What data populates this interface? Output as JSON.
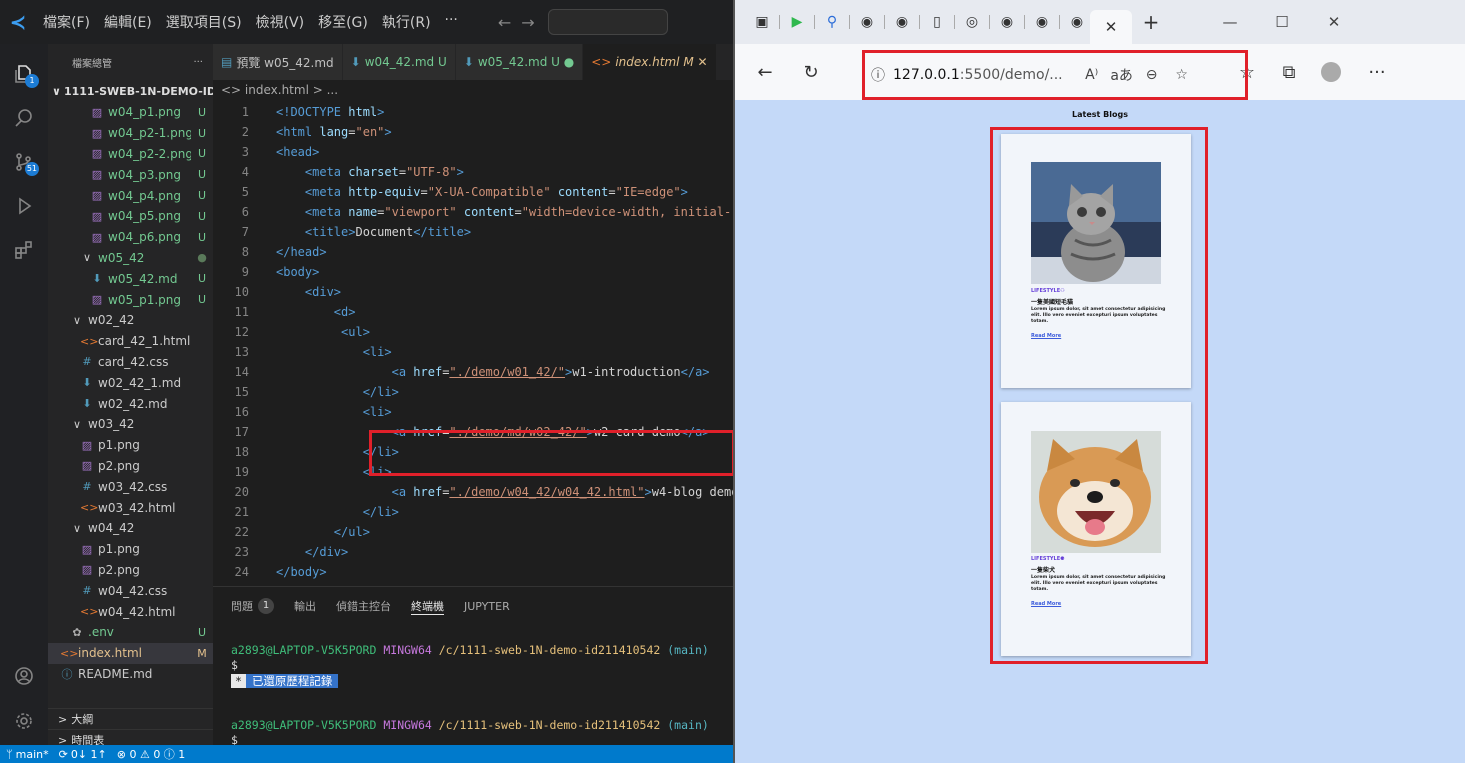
{
  "titlebar": {
    "menus": [
      "檔案(F)",
      "編輯(E)",
      "選取項目(S)",
      "檢視(V)",
      "移至(G)",
      "執行(R)",
      "···"
    ]
  },
  "activity": {
    "explorer_badge": "1",
    "scm_badge": "51"
  },
  "sidebar": {
    "header": "檔案總管",
    "more": "···",
    "root": "1111-SWEB-1N-DEMO-ID2...",
    "rows": [
      {
        "icon": "image",
        "name": "w04_p1.png",
        "status": "U",
        "depth": 3
      },
      {
        "icon": "image",
        "name": "w04_p2-1.png",
        "status": "U",
        "depth": 3
      },
      {
        "icon": "image",
        "name": "w04_p2-2.png",
        "status": "U",
        "depth": 3
      },
      {
        "icon": "image",
        "name": "w04_p3.png",
        "status": "U",
        "depth": 3
      },
      {
        "icon": "image",
        "name": "w04_p4.png",
        "status": "U",
        "depth": 3
      },
      {
        "icon": "image",
        "name": "w04_p5.png",
        "status": "U",
        "depth": 3
      },
      {
        "icon": "image",
        "name": "w04_p6.png",
        "status": "U",
        "depth": 3
      },
      {
        "icon": "folder",
        "name": "w05_42",
        "status": "●",
        "depth": 2
      },
      {
        "icon": "md",
        "name": "w05_42.md",
        "status": "U",
        "depth": 3
      },
      {
        "icon": "image",
        "name": "w05_p1.png",
        "status": "U",
        "depth": 3
      },
      {
        "icon": "folder",
        "name": "w02_42",
        "status": "",
        "depth": 1
      },
      {
        "icon": "html",
        "name": "card_42_1.html",
        "status": "",
        "depth": 2
      },
      {
        "icon": "css",
        "name": "card_42.css",
        "status": "",
        "depth": 2
      },
      {
        "icon": "md",
        "name": "w02_42_1.md",
        "status": "",
        "depth": 2
      },
      {
        "icon": "md",
        "name": "w02_42.md",
        "status": "",
        "depth": 2
      },
      {
        "icon": "folder",
        "name": "w03_42",
        "status": "",
        "depth": 1
      },
      {
        "icon": "image",
        "name": "p1.png",
        "status": "",
        "depth": 2
      },
      {
        "icon": "image",
        "name": "p2.png",
        "status": "",
        "depth": 2
      },
      {
        "icon": "css",
        "name": "w03_42.css",
        "status": "",
        "depth": 2
      },
      {
        "icon": "html",
        "name": "w03_42.html",
        "status": "",
        "depth": 2
      },
      {
        "icon": "folder",
        "name": "w04_42",
        "status": "",
        "depth": 1
      },
      {
        "icon": "image",
        "name": "p1.png",
        "status": "",
        "depth": 2
      },
      {
        "icon": "image",
        "name": "p2.png",
        "status": "",
        "depth": 2
      },
      {
        "icon": "css",
        "name": "w04_42.css",
        "status": "",
        "depth": 2
      },
      {
        "icon": "html",
        "name": "w04_42.html",
        "status": "",
        "depth": 2
      },
      {
        "icon": "gear",
        "name": ".env",
        "status": "U",
        "depth": 1
      },
      {
        "icon": "html",
        "name": "index.html",
        "status": "M",
        "depth": 0,
        "selected": true
      },
      {
        "icon": "info",
        "name": "README.md",
        "status": "",
        "depth": 0
      }
    ],
    "outline": "大綱",
    "timeline": "時間表"
  },
  "tabs": [
    {
      "label": "預覽 w05_42.md",
      "color": "#c0c0c0"
    },
    {
      "label": "w04_42.md U",
      "color": "#73c991"
    },
    {
      "label": "w05_42.md U ●",
      "color": "#73c991"
    },
    {
      "label": "index.html M ✕",
      "color": "#e2c08d",
      "active": true
    }
  ],
  "breadcrumb": "<> index.html > ...",
  "code": [
    [
      [
        "tg",
        "<!DOCTYPE "
      ],
      [
        "at",
        "html"
      ],
      [
        "tg",
        ">"
      ]
    ],
    [
      [
        "tg",
        "<html "
      ],
      [
        "at",
        "lang"
      ],
      [
        "tx",
        "="
      ],
      [
        "sv",
        "\"en\""
      ],
      [
        "tg",
        ">"
      ]
    ],
    [
      [
        "tg",
        "<head>"
      ]
    ],
    [
      [
        "tx",
        "    "
      ],
      [
        "tg",
        "<meta "
      ],
      [
        "at",
        "charset"
      ],
      [
        "tx",
        "="
      ],
      [
        "sv",
        "\"UTF-8\""
      ],
      [
        "tg",
        ">"
      ]
    ],
    [
      [
        "tx",
        "    "
      ],
      [
        "tg",
        "<meta "
      ],
      [
        "at",
        "http-equiv"
      ],
      [
        "tx",
        "="
      ],
      [
        "sv",
        "\"X-UA-Compatible\""
      ],
      [
        "tx",
        " "
      ],
      [
        "at",
        "content"
      ],
      [
        "tx",
        "="
      ],
      [
        "sv",
        "\"IE=edge\""
      ],
      [
        "tg",
        ">"
      ]
    ],
    [
      [
        "tx",
        "    "
      ],
      [
        "tg",
        "<meta "
      ],
      [
        "at",
        "name"
      ],
      [
        "tx",
        "="
      ],
      [
        "sv",
        "\"viewport\""
      ],
      [
        "tx",
        " "
      ],
      [
        "at",
        "content"
      ],
      [
        "tx",
        "="
      ],
      [
        "sv",
        "\"width=device-width, initial-"
      ]
    ],
    [
      [
        "tx",
        "    "
      ],
      [
        "tg",
        "<title>"
      ],
      [
        "tx",
        "Document"
      ],
      [
        "tg",
        "</title>"
      ]
    ],
    [
      [
        "tg",
        "</head>"
      ]
    ],
    [
      [
        "tg",
        "<body>"
      ]
    ],
    [
      [
        "tx",
        "    "
      ],
      [
        "tg",
        "<div>"
      ]
    ],
    [
      [
        "tx",
        "        "
      ],
      [
        "tg",
        "<d>"
      ]
    ],
    [
      [
        "tx",
        "         "
      ],
      [
        "tg",
        "<ul>"
      ]
    ],
    [
      [
        "tx",
        "            "
      ],
      [
        "tg",
        "<li>"
      ]
    ],
    [
      [
        "tx",
        "                "
      ],
      [
        "tg",
        "<a "
      ],
      [
        "at",
        "href"
      ],
      [
        "tx",
        "="
      ],
      [
        "lk",
        "\"./demo/w01_42/\""
      ],
      [
        "tg",
        ">"
      ],
      [
        "tx",
        "w1-introduction"
      ],
      [
        "tg",
        "</a>"
      ]
    ],
    [
      [
        "tx",
        "            "
      ],
      [
        "tg",
        "</li>"
      ]
    ],
    [
      [
        "tx",
        "            "
      ],
      [
        "tg",
        "<li>"
      ]
    ],
    [
      [
        "tx",
        "                "
      ],
      [
        "tg",
        "<a "
      ],
      [
        "at",
        "href"
      ],
      [
        "tx",
        "="
      ],
      [
        "lk",
        "\"./demo/md/w02_42/\""
      ],
      [
        "tg",
        ">"
      ],
      [
        "tx",
        "w2-card demo"
      ],
      [
        "tg",
        "</a>"
      ]
    ],
    [
      [
        "tx",
        "            "
      ],
      [
        "tg",
        "</li>"
      ]
    ],
    [
      [
        "tx",
        "            "
      ],
      [
        "tg",
        "<li>"
      ]
    ],
    [
      [
        "tx",
        "                "
      ],
      [
        "tg",
        "<a "
      ],
      [
        "at",
        "href"
      ],
      [
        "tx",
        "="
      ],
      [
        "lk",
        "\"./demo/w04_42/w04_42.html\""
      ],
      [
        "tg",
        ">"
      ],
      [
        "tx",
        "w4-blog demo"
      ]
    ],
    [
      [
        "tx",
        "            "
      ],
      [
        "tg",
        "</li>"
      ]
    ],
    [
      [
        "tx",
        "        "
      ],
      [
        "tg",
        "</ul>"
      ]
    ],
    [
      [
        "tx",
        "    "
      ],
      [
        "tg",
        "</div>"
      ]
    ],
    [
      [
        "tg",
        "</body>"
      ]
    ],
    [
      [
        "tg",
        "</html>"
      ]
    ]
  ],
  "panel": {
    "problems": "問題",
    "problems_count": "1",
    "output": "輸出",
    "debug": "偵錯主控台",
    "terminal": "終端機",
    "jupyter": "JUPYTER"
  },
  "terminal": {
    "user": "a2893@LAPTOP-V5K5PORD",
    "shell": "MINGW64",
    "path1": "/c/1111-sweb-1N-demo-id211410542",
    "path2": "/c/1111-sweb-1N-demo-id211410542",
    "branch": "(main)",
    "prompt": "$",
    "restored": "已還原歷程記錄",
    "star": "*"
  },
  "statusbar": {
    "branch": "main*",
    "sync": "0↓ 1↑",
    "errors": "⊗ 0 ⚠ 0 ⓘ 1"
  },
  "browser": {
    "url_host": "127.0.0.1",
    "url_rest": ":5500/demo/...",
    "read_aloud": "A⁾",
    "translate": "aあ"
  },
  "page": {
    "title": "Latest Blogs",
    "cards": [
      {
        "category": "LIFESTYLE⚇",
        "heading": "一隻美國短毛貓",
        "body": "Lorem ipsum dolor, sit amet consectetur adipisicing elit. Illo vero eveniet excepturi ipsum voluptates totam.",
        "more": "Read More"
      },
      {
        "category": "LIFESTYLE⚈",
        "heading": "一隻柴犬",
        "body": "Lorem ipsum dolor, sit amet consectetur adipisicing elit. Illo vero eveniet excepturi ipsum voluptates totam.",
        "more": "Read More"
      }
    ]
  },
  "colors": {
    "accent": "#007acc",
    "highlight": "#e0202a",
    "page_bg": "#c4d9f8",
    "category": "#6741d9"
  }
}
